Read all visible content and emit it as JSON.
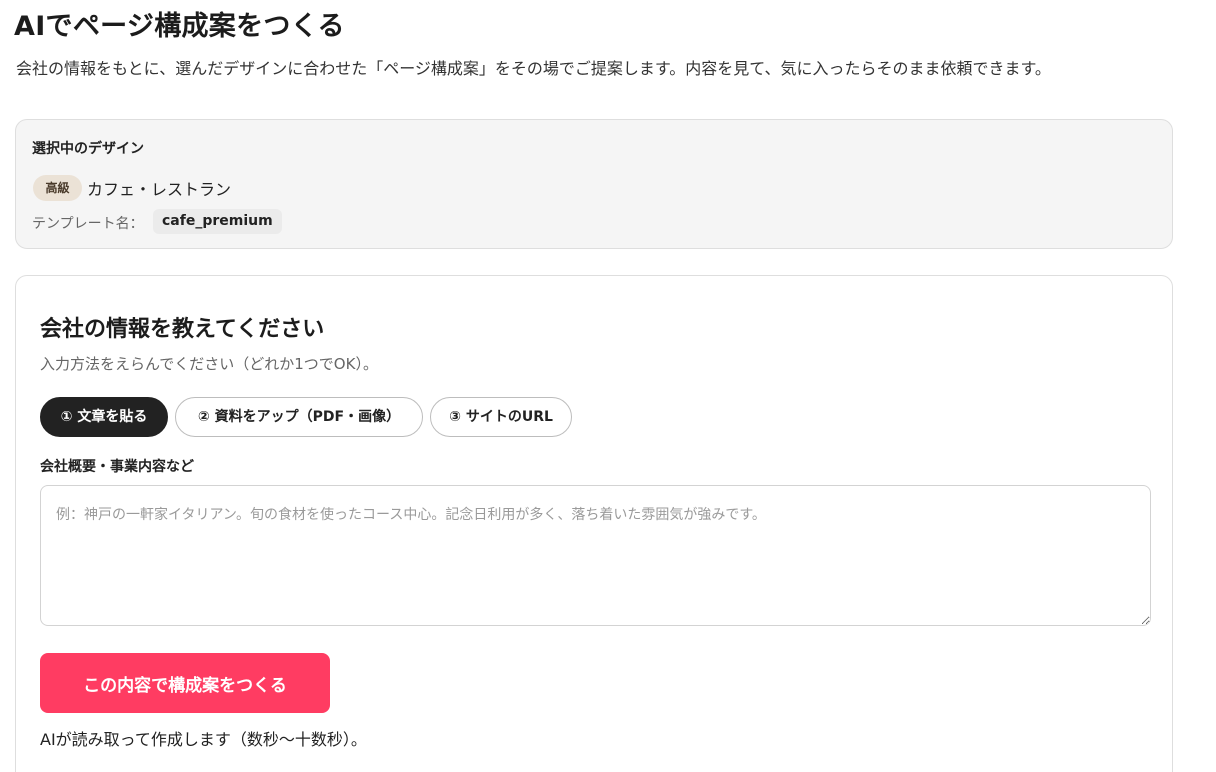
{
  "header": {
    "title": "AIでページ構成案をつくる",
    "intro": "会社の情報をもとに、選んだデザインに合わせた「ページ構成案」をその場でご提案します。内容を見て、気に入ったらそのまま依頼できます。"
  },
  "selected_design": {
    "heading": "選択中のデザイン",
    "badge": "高級",
    "name": "カフェ・レストラン",
    "template_label": "テンプレート名：",
    "template_code": "cafe_premium"
  },
  "form": {
    "heading": "会社の情報を教えてください",
    "subtitle": "入力方法をえらんでください（どれか1つでOK）。",
    "tabs": [
      {
        "label": "① 文章を貼る",
        "active": true
      },
      {
        "label": "② 資料をアップ（PDF・画像）",
        "active": false
      },
      {
        "label": "③ サイトのURL",
        "active": false
      }
    ],
    "field_label": "会社概要・事業内容など",
    "field_value": "",
    "field_placeholder": "例：神戸の一軒家イタリアン。旬の食材を使ったコース中心。記念日利用が多く、落ち着いた雰囲気が強みです。",
    "submit_label": "この内容で構成案をつくる",
    "submit_note": "AIが読み取って作成します（数秒〜十数秒）。"
  },
  "colors": {
    "accent": "#ff3c62",
    "active_tab": "#222222",
    "badge_bg": "#ebe2d6",
    "card_bg": "#f5f5f5"
  }
}
